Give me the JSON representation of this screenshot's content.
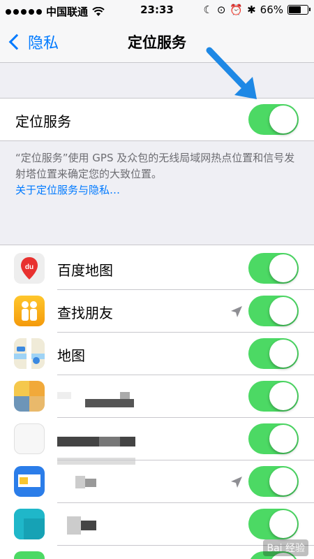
{
  "status_bar": {
    "carrier": "中国联通",
    "time": "23:33",
    "battery": "66%",
    "battery_level": 0.66
  },
  "nav": {
    "back_label": "隐私",
    "title": "定位服务"
  },
  "location_services": {
    "label": "定位服务",
    "enabled": true
  },
  "description": {
    "text": "“定位服务”使用 GPS 及众包的无线局域网热点位置和信号发射塔位置来确定您的大致位置。",
    "link": "关于定位服务与隐私…"
  },
  "apps": [
    {
      "name": "百度地图",
      "icon": "baidu-map-icon",
      "enabled": true,
      "recent_location": false
    },
    {
      "name": "查找朋友",
      "icon": "find-friends-icon",
      "enabled": true,
      "recent_location": true
    },
    {
      "name": "地图",
      "icon": "maps-icon",
      "enabled": true,
      "recent_location": false
    },
    {
      "name": "",
      "icon": "blurred-app-icon",
      "enabled": true,
      "recent_location": false
    },
    {
      "name": "",
      "icon": "blurred-app-icon",
      "enabled": true,
      "recent_location": false
    },
    {
      "name": "",
      "icon": "blurred-app-icon",
      "enabled": true,
      "recent_location": true
    },
    {
      "name": "",
      "icon": "blurred-app-icon",
      "enabled": true,
      "recent_location": false
    }
  ],
  "watermark": "Bai 经验",
  "colors": {
    "ios_blue": "#007aff",
    "toggle_green": "#4cd964",
    "background": "#efeff4"
  }
}
